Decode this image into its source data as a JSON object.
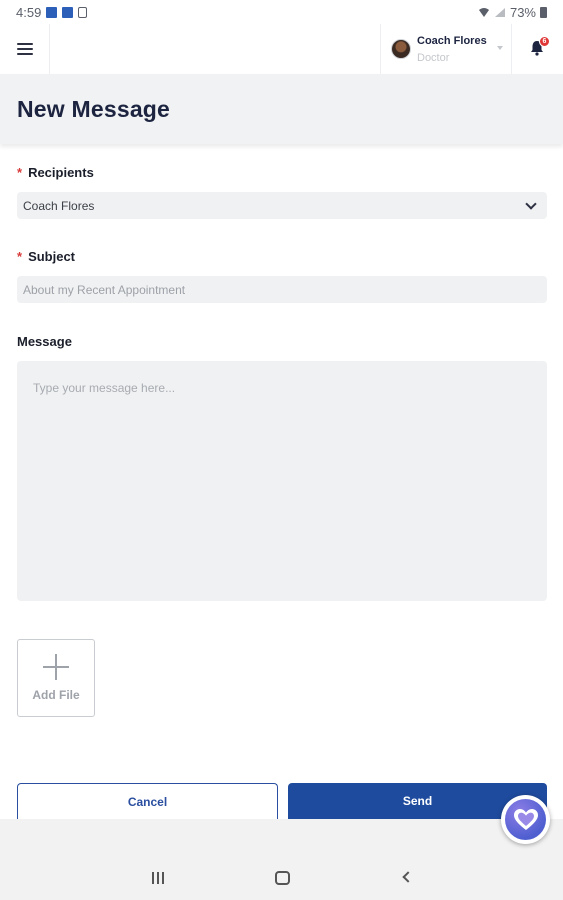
{
  "status_bar": {
    "time": "4:59",
    "battery": "73%",
    "icons": [
      "app-notification-icon",
      "app-notification-icon",
      "sim-icon",
      "wifi-icon",
      "signal-icon",
      "battery-icon"
    ]
  },
  "header": {
    "menu_icon": "hamburger-menu-icon",
    "user_name": "Coach Flores",
    "user_role": "Doctor",
    "notification_count": "6",
    "notification_icon": "bell-icon"
  },
  "page": {
    "title": "New Message"
  },
  "form": {
    "recipients": {
      "label": "Recipients",
      "required_mark": "*",
      "selected": "Coach Flores"
    },
    "subject": {
      "label": "Subject",
      "required_mark": "*",
      "placeholder": "About my Recent Appointment"
    },
    "message": {
      "label": "Message",
      "placeholder": "Type your message here..."
    },
    "add_file_label": "Add File"
  },
  "actions": {
    "cancel_label": "Cancel",
    "send_label": "Send"
  },
  "colors": {
    "primary": "#1f4b9e",
    "title_text": "#1c2440",
    "required": "#d83a3a",
    "field_bg": "#f0f1f2",
    "badge": "#e03737"
  },
  "floating_button": {
    "icon": "heart-icon"
  },
  "nav_bar": {
    "icons": [
      "recent-apps-icon",
      "home-icon",
      "back-icon"
    ]
  }
}
